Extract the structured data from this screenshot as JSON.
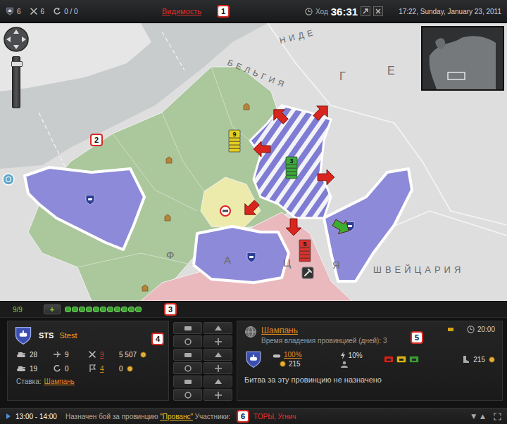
{
  "top_bar": {
    "stats": [
      {
        "value": "6"
      },
      {
        "value": "6"
      },
      {
        "value": "0 / 0"
      }
    ],
    "visibility": "Видимость",
    "turn_label": "Ход",
    "turn_timer": "36:31",
    "datetime": "17:22, Sunday, January 23, 2011"
  },
  "callouts": [
    "1",
    "2",
    "3",
    "4",
    "5",
    "6"
  ],
  "map": {
    "labels": [
      "НИДЕ",
      "БЕЛЬГИЯ",
      "Г",
      "Е",
      "ШВЕЙЦАРИЯ",
      "Ф",
      "А",
      "Ц",
      "Я"
    ],
    "regions": [
      {
        "kind": "land",
        "color": "#abc79c"
      },
      {
        "kind": "land",
        "color": "#ecebab"
      },
      {
        "kind": "land",
        "color": "#eab9be"
      },
      {
        "kind": "owned",
        "color": "#8d8ad9"
      },
      {
        "kind": "owned",
        "color": "#8d8ad9"
      },
      {
        "kind": "owned",
        "color": "#8d8ad9"
      },
      {
        "kind": "hatched",
        "color": "#7f7cd3"
      }
    ],
    "stacks": [
      {
        "count": "9",
        "color": "#e6cf1f"
      },
      {
        "count": "3",
        "color": "#3caa3c"
      },
      {
        "count": "5",
        "color": "#d9322b"
      }
    ],
    "arrows": [
      {
        "color": "#d8261f"
      },
      {
        "color": "#d8261f"
      },
      {
        "color": "#d8261f"
      },
      {
        "color": "#d8261f"
      },
      {
        "color": "#d8261f"
      },
      {
        "color": "#d8261f"
      },
      {
        "color": "#3cae2f"
      }
    ]
  },
  "strip": {
    "count": "9/9",
    "add_button": "+",
    "slots": [
      {
        "filled": true
      },
      {
        "filled": true
      },
      {
        "filled": true
      },
      {
        "filled": true
      },
      {
        "filled": true
      },
      {
        "filled": true
      },
      {
        "filled": true
      },
      {
        "filled": true
      },
      {
        "filled": true
      },
      {
        "filled": true
      },
      {
        "filled": true
      }
    ]
  },
  "clan_panel": {
    "tag": "STS",
    "name": "Stest",
    "stats": [
      {
        "value": "28",
        "kind": "plain",
        "color": "#e0e0e0"
      },
      {
        "value": "9",
        "kind": "plain",
        "color": "#e0e0e0"
      },
      {
        "value": "9",
        "kind": "link",
        "color": "#d63a2a"
      },
      {
        "value": "5 507",
        "kind": "plain",
        "color": "#e0e0e0"
      },
      {
        "value": "19",
        "kind": "plain",
        "color": "#e0e0e0"
      },
      {
        "value": "0",
        "kind": "plain",
        "color": "#e0e0e0"
      },
      {
        "value": "4",
        "kind": "link",
        "color": "#e08a1e"
      },
      {
        "value": "0",
        "kind": "plain",
        "color": "#e0e0e0"
      }
    ],
    "bid_label": "Ставка:",
    "bid_province": "Шампань"
  },
  "province_panel": {
    "name": "Шампань",
    "hold_time": "Время владения провинцией (дней): 3",
    "battle_time": "20:00",
    "owner_share": "100%",
    "income": "215",
    "tax": "10%",
    "chips": [
      {
        "color": "#c8271f"
      },
      {
        "color": "#d6b21a"
      },
      {
        "color": "#3e9a36"
      }
    ],
    "revenue": "215",
    "battle_status": "Битва за эту провинцию не назначено"
  },
  "event_bar": {
    "time": "13:00 - 14:00",
    "text": "Назначен бой за провинцию ",
    "province": "\"Прованс\"",
    "participants_label": " Участники: ",
    "participants": "ТОРЫ, Угнич",
    "arrows": [
      "▼",
      "▲"
    ]
  }
}
